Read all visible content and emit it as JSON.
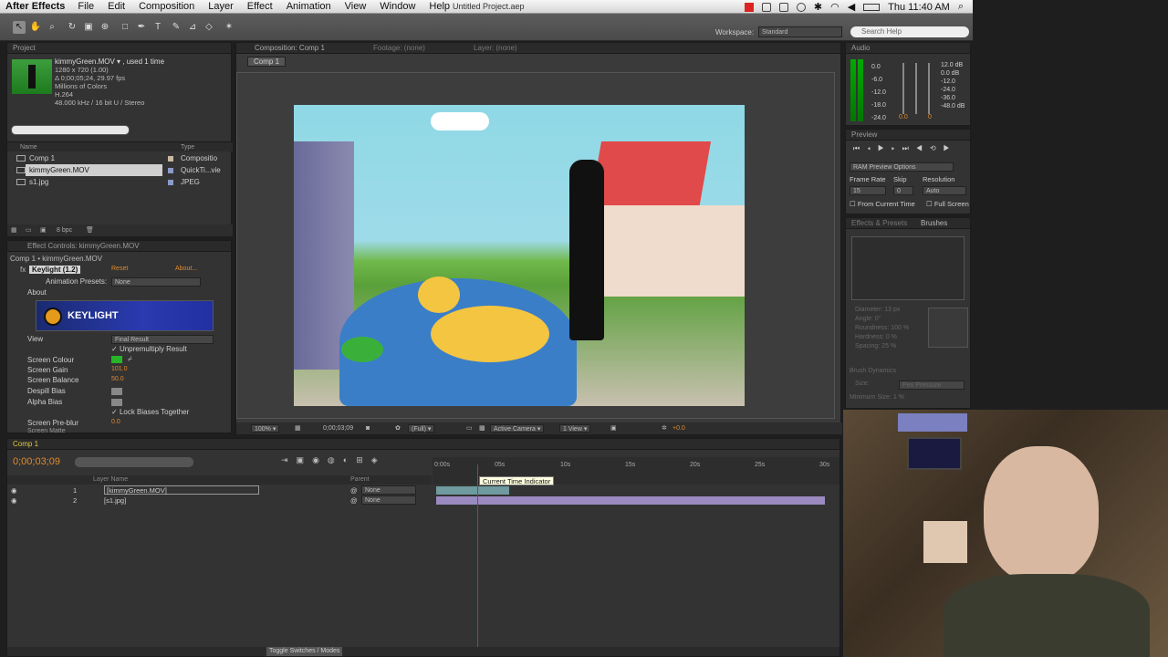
{
  "menubar": {
    "app": "After Effects",
    "items": [
      "File",
      "Edit",
      "Composition",
      "Layer",
      "Effect",
      "Animation",
      "View",
      "Window",
      "Help"
    ],
    "doc_title": "Untitled Project.aep",
    "clock": "Thu 11:40 AM"
  },
  "toolbar": {
    "workspace_label": "Workspace:",
    "workspace_value": "Standard",
    "search_placeholder": "Search Help"
  },
  "project": {
    "tab": "Project",
    "item_name": "kimmyGreen.MOV ▾ , used 1 time",
    "info": [
      "1280 x 720 (1.00)",
      "Δ 0;00;05;24, 29.97 fps",
      "Millions of Colors",
      "H.264",
      "48.000 kHz / 16 bit U / Stereo"
    ],
    "col_name": "Name",
    "col_type": "Type",
    "items": [
      {
        "name": "Comp 1",
        "type": "Compositio"
      },
      {
        "name": "kimmyGreen.MOV",
        "type": "QuickTi...vie"
      },
      {
        "name": "s1.jpg",
        "type": "JPEG"
      }
    ],
    "bpc": "8 bpc"
  },
  "effects": {
    "tab": "Effect Controls: kimmyGreen.MOV",
    "path": "Comp 1 • kimmyGreen.MOV",
    "effect": "Keylight (1.2)",
    "reset": "Reset",
    "about_btn": "About...",
    "presets_label": "Animation Presets:",
    "presets_value": "None",
    "about": "About",
    "logo": "KEYLIGHT",
    "view_label": "View",
    "view_value": "Final Result",
    "unpremultiply": "Unpremultiply Result",
    "screen_colour": "Screen Colour",
    "screen_gain": "Screen Gain",
    "screen_gain_val": "101.0",
    "screen_balance": "Screen Balance",
    "screen_balance_val": "50.0",
    "despill": "Despill Bias",
    "alpha": "Alpha Bias",
    "lock": "Lock Biases Together",
    "pre_blur": "Screen Pre-blur",
    "pre_blur_val": "0.0",
    "screen_matte": "Screen Matte"
  },
  "composition": {
    "tab": "Composition: Comp 1",
    "footage_tab": "Footage: (none)",
    "layer_tab": "Layer: (none)",
    "subtab": "Comp 1",
    "zoom": "100%",
    "timecode": "0;00;03;09",
    "quality": "(Full)",
    "camera": "Active Camera",
    "views": "1 View",
    "exposure": "+0.0"
  },
  "audio": {
    "tab": "Audio",
    "left": [
      "0.0",
      "-6.0",
      "-12.0",
      "-18.0",
      "-24.0"
    ],
    "right": [
      "12.0 dB",
      "0.0 dB",
      "-12.0",
      "-24.0",
      "-36.0",
      "-48.0 dB"
    ],
    "zero_a": "0.0",
    "zero_b": "0"
  },
  "preview": {
    "tab": "Preview",
    "ram": "RAM Preview Options",
    "frame_rate": "Frame Rate",
    "skip": "Skip",
    "resolution": "Resolution",
    "frame_rate_val": "15",
    "skip_val": "0",
    "resolution_val": "Auto",
    "from_current": "From Current Time",
    "full_screen": "Full Screen"
  },
  "brushes": {
    "tab_effects": "Effects & Presets",
    "tab_brushes": "Brushes",
    "props": [
      "Diameter: 13 px",
      "Angle: 0°",
      "Roundness: 100 %",
      "Hardness: 0 %",
      "Spacing: 25 %"
    ],
    "dynamics": "Brush Dynamics",
    "size_label": "Size:",
    "size_val": "Pen Pressure",
    "min_size": "Minimum Size: 1 %"
  },
  "timeline": {
    "tab": "Comp 1",
    "timecode": "0;00;03;09",
    "col_layer": "Layer Name",
    "col_parent": "Parent",
    "layers": [
      {
        "num": "1",
        "name": "[kimmyGreen.MOV]",
        "parent": "None"
      },
      {
        "num": "2",
        "name": "[s1.jpg]",
        "parent": "None"
      }
    ],
    "ticks": [
      "0:00s",
      "05s",
      "10s",
      "15s",
      "20s",
      "25s",
      "30s"
    ],
    "tooltip": "Current Time Indicator",
    "toggle": "Toggle Switches / Modes"
  }
}
